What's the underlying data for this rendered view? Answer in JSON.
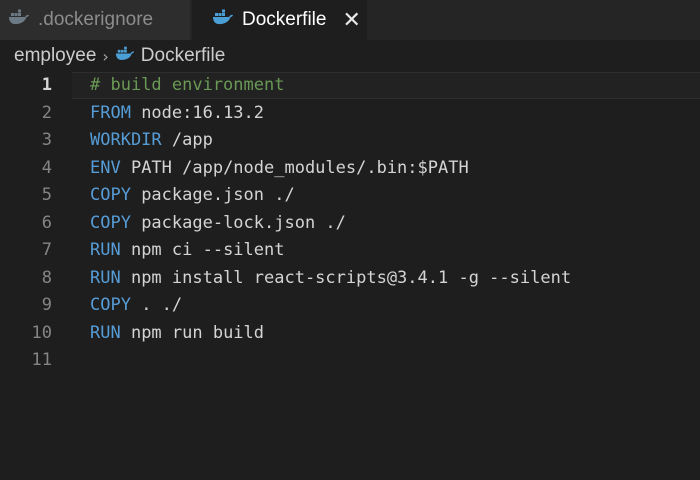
{
  "tabs": [
    {
      "label": ".dockerignore",
      "active": false,
      "icon": "docker-whale-icon"
    },
    {
      "label": "Dockerfile",
      "active": true,
      "icon": "docker-whale-icon",
      "close_glyph": "✕"
    }
  ],
  "breadcrumb": {
    "folder": "employee",
    "separator": "›",
    "file": "Dockerfile"
  },
  "editor": {
    "active_line": 1,
    "lines": [
      {
        "num": "1",
        "keyword": "",
        "text": "# build environment",
        "comment": true
      },
      {
        "num": "2",
        "keyword": "FROM",
        "text": " node:16.13.2",
        "comment": false
      },
      {
        "num": "3",
        "keyword": "WORKDIR",
        "text": " /app",
        "comment": false
      },
      {
        "num": "4",
        "keyword": "ENV",
        "text": " PATH /app/node_modules/.bin:$PATH",
        "comment": false
      },
      {
        "num": "5",
        "keyword": "COPY",
        "text": " package.json ./",
        "comment": false
      },
      {
        "num": "6",
        "keyword": "COPY",
        "text": " package-lock.json ./",
        "comment": false
      },
      {
        "num": "7",
        "keyword": "RUN",
        "text": " npm ci --silent",
        "comment": false
      },
      {
        "num": "8",
        "keyword": "RUN",
        "text": " npm install react-scripts@3.4.1 -g --silent",
        "comment": false
      },
      {
        "num": "9",
        "keyword": "COPY",
        "text": " . ./",
        "comment": false
      },
      {
        "num": "10",
        "keyword": "RUN",
        "text": " npm run build",
        "comment": false
      },
      {
        "num": "11",
        "keyword": "",
        "text": "",
        "comment": false
      }
    ]
  },
  "colors": {
    "background": "#1e1e1e",
    "tabbar": "#252526",
    "inactive_tab": "#2d2d2d",
    "keyword": "#569cd6",
    "comment": "#6a9955",
    "text": "#d4d4d4",
    "line_number": "#858585",
    "docker_blue": "#4b9fd5"
  }
}
